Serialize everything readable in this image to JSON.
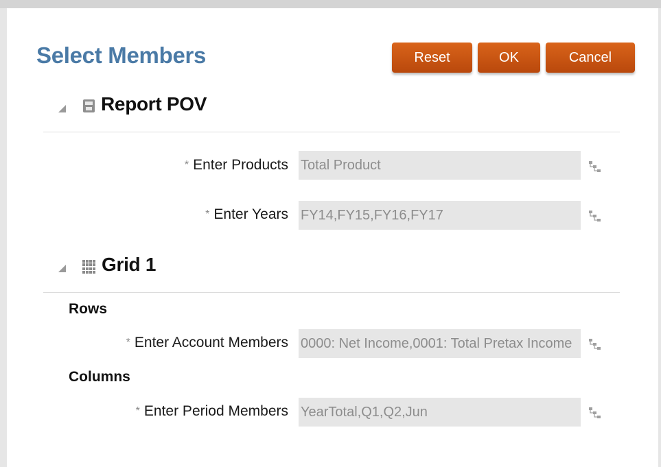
{
  "dialog": {
    "title": "Select Members",
    "buttons": {
      "reset": "Reset",
      "ok": "OK",
      "cancel": "Cancel"
    }
  },
  "report_pov": {
    "title": "Report POV",
    "fields": [
      {
        "label": "Enter Products",
        "value": "Total Product"
      },
      {
        "label": "Enter Years",
        "value": "FY14,FY15,FY16,FY17"
      }
    ]
  },
  "grid": {
    "title": "Grid 1",
    "rows_label": "Rows",
    "columns_label": "Columns",
    "rows_field": {
      "label": "Enter Account Members",
      "value": "0000: Net Income,0001: Total Pretax Income"
    },
    "columns_field": {
      "label": "Enter Period Members",
      "value": "YearTotal,Q1,Q2,Jun"
    }
  },
  "required_marker": "*",
  "colors": {
    "title": "#4a7aa6",
    "button": "#c9560f",
    "field_bg": "#e6e6e6"
  },
  "icons": [
    "collapse-triangle-icon",
    "report-pov-icon",
    "grid-icon",
    "member-selector-icon"
  ]
}
